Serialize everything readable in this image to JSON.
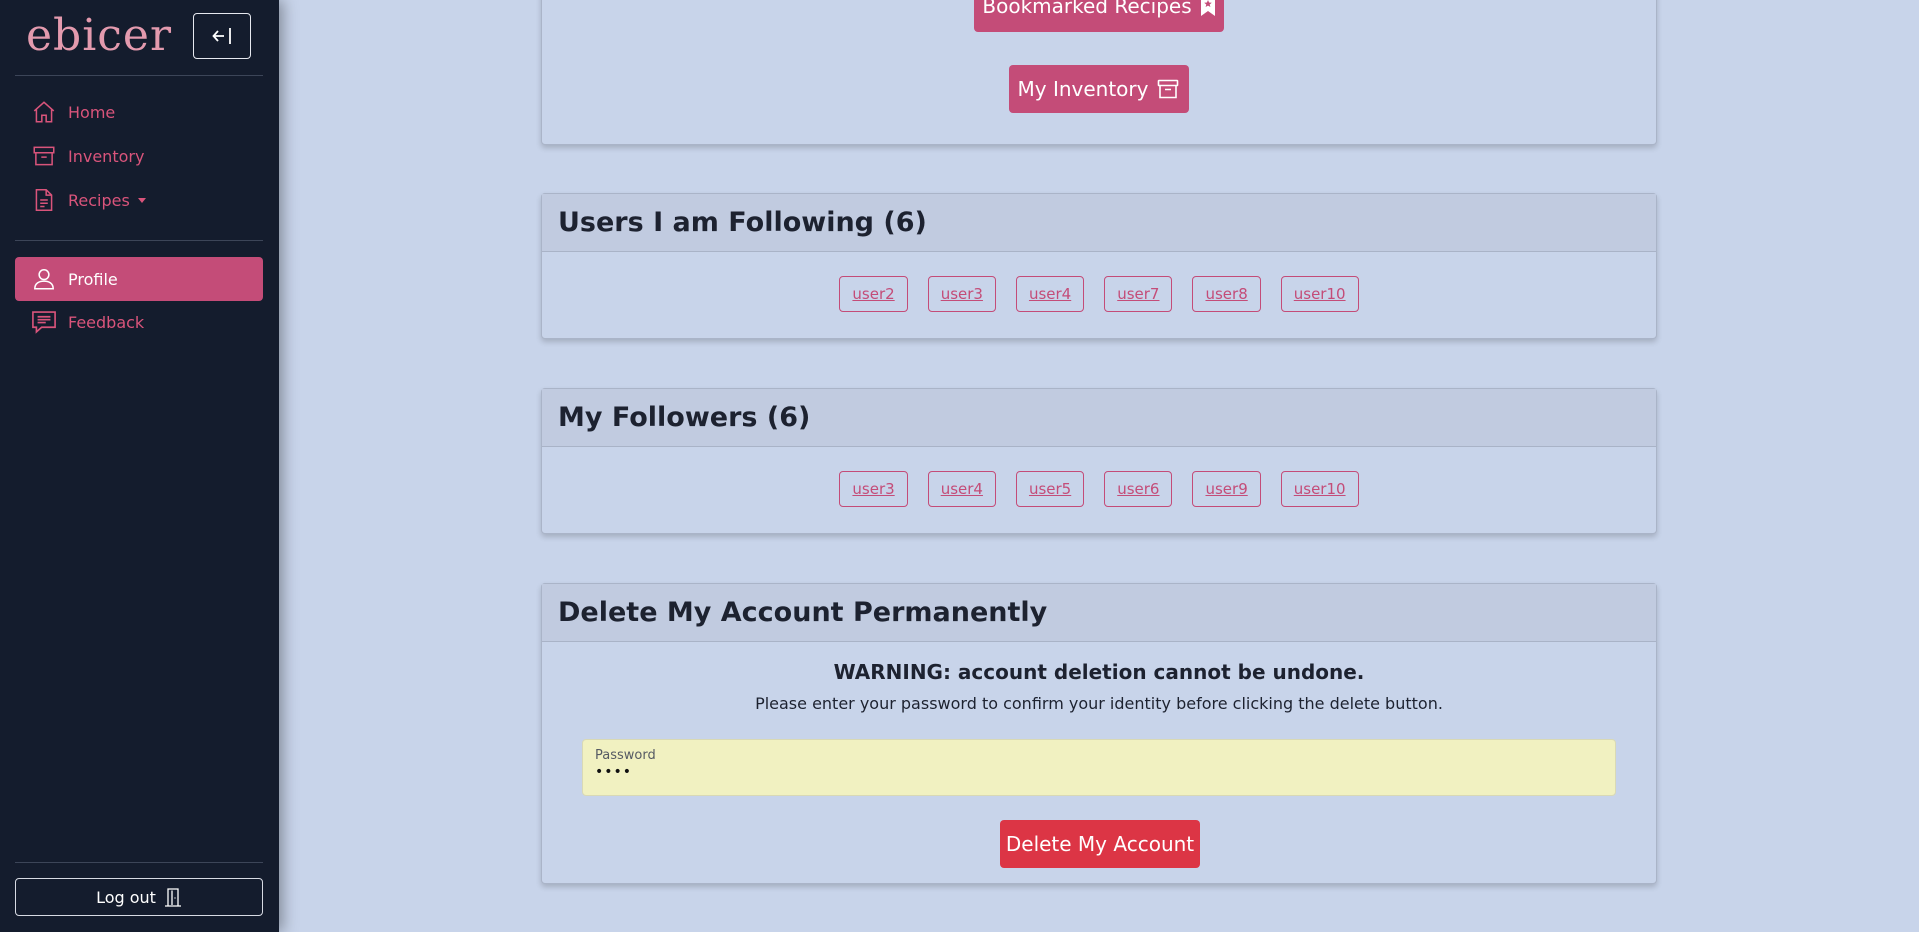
{
  "sidebar": {
    "logo": "ebicer",
    "items": [
      {
        "label": "Home",
        "icon": "home-icon"
      },
      {
        "label": "Inventory",
        "icon": "archive-box-icon"
      },
      {
        "label": "Recipes",
        "icon": "document-icon"
      },
      {
        "label": "Profile",
        "icon": "user-icon",
        "active": true
      },
      {
        "label": "Feedback",
        "icon": "chat-icon"
      }
    ],
    "logout_label": "Log out"
  },
  "top_card": {
    "bookmarked_label": "Bookmarked Recipes",
    "inventory_label": "My Inventory"
  },
  "following": {
    "title": "Users I am Following (6)",
    "users": [
      "user2",
      "user3",
      "user4",
      "user7",
      "user8",
      "user10"
    ]
  },
  "followers": {
    "title": "My Followers (6)",
    "users": [
      "user3",
      "user4",
      "user5",
      "user6",
      "user9",
      "user10"
    ]
  },
  "delete_account": {
    "title": "Delete My Account Permanently",
    "warning": "WARNING: account deletion cannot be undone.",
    "hint": "Please enter your password to confirm your identity before clicking the delete button.",
    "password_label": "Password",
    "password_value": "••••",
    "delete_label": "Delete My Account"
  },
  "colors": {
    "accent": "#c44c78",
    "sidebar_bg": "#141c2d",
    "page_bg": "#c8d4ea",
    "danger": "#dc3545"
  }
}
